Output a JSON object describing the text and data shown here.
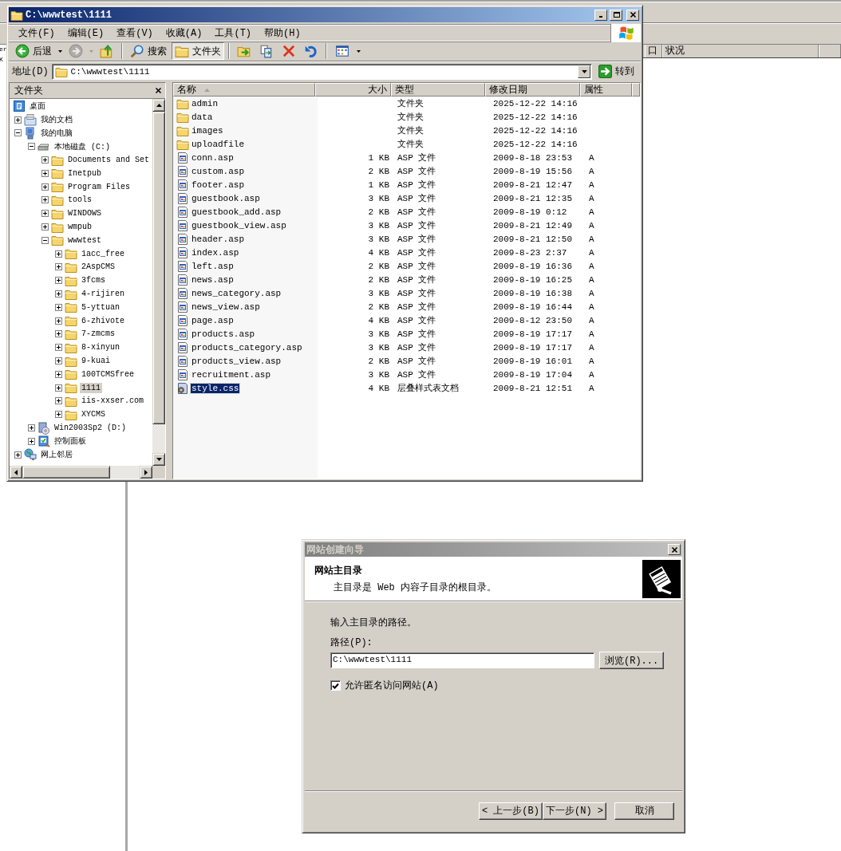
{
  "background_window": {
    "left_texts": [
      "er",
      "K"
    ],
    "columns": [
      "口",
      "状况"
    ]
  },
  "explorer": {
    "title": "C:\\wwwtest\\1111",
    "menu": [
      "文件(F)",
      "编辑(E)",
      "查看(V)",
      "收藏(A)",
      "工具(T)",
      "帮助(H)"
    ],
    "toolbar": [
      [
        {
          "kind": "back",
          "label": "后退",
          "disabled": false,
          "selected": false
        },
        {
          "kind": "forward",
          "disabled": true,
          "selected": false
        },
        {
          "kind": "up",
          "disabled": false,
          "selected": false
        }
      ],
      [
        {
          "kind": "search",
          "label": "搜索",
          "disabled": false,
          "selected": false
        },
        {
          "kind": "folders",
          "label": "文件夹",
          "disabled": false,
          "selected": true
        }
      ],
      [
        {
          "kind": "move",
          "disabled": false,
          "selected": false
        },
        {
          "kind": "copy",
          "disabled": false,
          "selected": false
        },
        {
          "kind": "delete",
          "disabled": false,
          "selected": false
        },
        {
          "kind": "undo",
          "disabled": false,
          "selected": false
        }
      ],
      [
        {
          "kind": "views",
          "disabled": false,
          "selected": false
        }
      ]
    ],
    "address": {
      "label": "地址(D)",
      "value": "C:\\wwwtest\\1111",
      "go": "转到"
    },
    "folders": {
      "title": "文件夹",
      "tree": [
        {
          "kind": "desktop",
          "label": "桌面",
          "selected": false,
          "children": [
            {
              "kind": "documents",
              "label": "我的文档",
              "expanded": false,
              "selected": false
            },
            {
              "kind": "computer",
              "label": "我的电脑",
              "expanded": true,
              "selected": false,
              "children": [
                {
                  "kind": "drive",
                  "label": "本地磁盘 (C:)",
                  "expanded": true,
                  "selected": false,
                  "children": [
                    {
                      "kind": "folder",
                      "label": "Documents and Set",
                      "expanded": false,
                      "selected": false
                    },
                    {
                      "kind": "folder",
                      "label": "Inetpub",
                      "expanded": false,
                      "selected": false
                    },
                    {
                      "kind": "folder",
                      "label": "Program Files",
                      "expanded": false,
                      "selected": false
                    },
                    {
                      "kind": "folder",
                      "label": "tools",
                      "expanded": false,
                      "selected": false
                    },
                    {
                      "kind": "folder",
                      "label": "WINDOWS",
                      "expanded": false,
                      "selected": false
                    },
                    {
                      "kind": "folder",
                      "label": "wmpub",
                      "expanded": false,
                      "selected": false
                    },
                    {
                      "kind": "folder",
                      "label": "wwwtest",
                      "expanded": true,
                      "selected": false,
                      "children": [
                        {
                          "kind": "folder",
                          "label": "1acc_free",
                          "expanded": false,
                          "selected": false
                        },
                        {
                          "kind": "folder",
                          "label": "2AspCMS",
                          "expanded": false,
                          "selected": false
                        },
                        {
                          "kind": "folder",
                          "label": "3fcms",
                          "expanded": false,
                          "selected": false
                        },
                        {
                          "kind": "folder",
                          "label": "4-rijiren",
                          "expanded": false,
                          "selected": false
                        },
                        {
                          "kind": "folder",
                          "label": "5-yttuan",
                          "expanded": false,
                          "selected": false
                        },
                        {
                          "kind": "folder",
                          "label": "6-zhivote",
                          "expanded": false,
                          "selected": false
                        },
                        {
                          "kind": "folder",
                          "label": "7-zmcms",
                          "expanded": false,
                          "selected": false
                        },
                        {
                          "kind": "folder",
                          "label": "8-xinyun",
                          "expanded": false,
                          "selected": false
                        },
                        {
                          "kind": "folder",
                          "label": "9-kuai",
                          "expanded": false,
                          "selected": false
                        },
                        {
                          "kind": "folder",
                          "label": "100TCMSfree",
                          "expanded": false,
                          "selected": false
                        },
                        {
                          "kind": "folder",
                          "label": "1111",
                          "expanded": false,
                          "selected": true
                        },
                        {
                          "kind": "folder",
                          "label": "iis-xxser.com",
                          "expanded": false,
                          "selected": false
                        },
                        {
                          "kind": "folder",
                          "label": "XYCMS",
                          "expanded": false,
                          "selected": false
                        }
                      ]
                    }
                  ]
                },
                {
                  "kind": "cd",
                  "label": "Win2003Sp2 (D:)",
                  "expanded": false,
                  "selected": false
                },
                {
                  "kind": "control",
                  "label": "控制面板",
                  "expanded": false,
                  "selected": false
                }
              ]
            },
            {
              "kind": "network",
              "label": "网上邻居",
              "expanded": false,
              "selected": false
            }
          ]
        }
      ]
    },
    "list": {
      "columns": [
        {
          "label": "名称",
          "sorted": true
        },
        {
          "label": "大小",
          "sorted": false
        },
        {
          "label": "类型",
          "sorted": false
        },
        {
          "label": "修改日期",
          "sorted": false
        },
        {
          "label": "属性",
          "sorted": false
        }
      ],
      "rows": [
        {
          "kind": "folder",
          "name": "admin",
          "type": "文件夹",
          "modified": "2025-12-22 14:16",
          "selected": false
        },
        {
          "kind": "folder",
          "name": "data",
          "type": "文件夹",
          "modified": "2025-12-22 14:16",
          "selected": false
        },
        {
          "kind": "folder",
          "name": "images",
          "type": "文件夹",
          "modified": "2025-12-22 14:16",
          "selected": false
        },
        {
          "kind": "folder",
          "name": "uploadfile",
          "type": "文件夹",
          "modified": "2025-12-22 14:16",
          "selected": false
        },
        {
          "kind": "asp",
          "name": "conn.asp",
          "size": "1 KB",
          "type": "ASP 文件",
          "modified": "2009-8-18 23:53",
          "attributes": "A",
          "selected": false
        },
        {
          "kind": "asp",
          "name": "custom.asp",
          "size": "2 KB",
          "type": "ASP 文件",
          "modified": "2009-8-19 15:56",
          "attributes": "A",
          "selected": false
        },
        {
          "kind": "asp",
          "name": "footer.asp",
          "size": "1 KB",
          "type": "ASP 文件",
          "modified": "2009-8-21 12:47",
          "attributes": "A",
          "selected": false
        },
        {
          "kind": "asp",
          "name": "guestbook.asp",
          "size": "3 KB",
          "type": "ASP 文件",
          "modified": "2009-8-21 12:35",
          "attributes": "A",
          "selected": false
        },
        {
          "kind": "asp",
          "name": "guestbook_add.asp",
          "size": "2 KB",
          "type": "ASP 文件",
          "modified": "2009-8-19 0:12",
          "attributes": "A",
          "selected": false
        },
        {
          "kind": "asp",
          "name": "guestbook_view.asp",
          "size": "3 KB",
          "type": "ASP 文件",
          "modified": "2009-8-21 12:49",
          "attributes": "A",
          "selected": false
        },
        {
          "kind": "asp",
          "name": "header.asp",
          "size": "3 KB",
          "type": "ASP 文件",
          "modified": "2009-8-21 12:50",
          "attributes": "A",
          "selected": false
        },
        {
          "kind": "asp",
          "name": "index.asp",
          "size": "4 KB",
          "type": "ASP 文件",
          "modified": "2009-8-23 2:37",
          "attributes": "A",
          "selected": false
        },
        {
          "kind": "asp",
          "name": "left.asp",
          "size": "2 KB",
          "type": "ASP 文件",
          "modified": "2009-8-19 16:36",
          "attributes": "A",
          "selected": false
        },
        {
          "kind": "asp",
          "name": "news.asp",
          "size": "2 KB",
          "type": "ASP 文件",
          "modified": "2009-8-19 16:25",
          "attributes": "A",
          "selected": false
        },
        {
          "kind": "asp",
          "name": "news_category.asp",
          "size": "3 KB",
          "type": "ASP 文件",
          "modified": "2009-8-19 16:38",
          "attributes": "A",
          "selected": false
        },
        {
          "kind": "asp",
          "name": "news_view.asp",
          "size": "2 KB",
          "type": "ASP 文件",
          "modified": "2009-8-19 16:44",
          "attributes": "A",
          "selected": false
        },
        {
          "kind": "asp",
          "name": "page.asp",
          "size": "4 KB",
          "type": "ASP 文件",
          "modified": "2009-8-12 23:50",
          "attributes": "A",
          "selected": false
        },
        {
          "kind": "asp",
          "name": "products.asp",
          "size": "3 KB",
          "type": "ASP 文件",
          "modified": "2009-8-19 17:17",
          "attributes": "A",
          "selected": false
        },
        {
          "kind": "asp",
          "name": "products_category.asp",
          "size": "3 KB",
          "type": "ASP 文件",
          "modified": "2009-8-19 17:17",
          "attributes": "A",
          "selected": false
        },
        {
          "kind": "asp",
          "name": "products_view.asp",
          "size": "2 KB",
          "type": "ASP 文件",
          "modified": "2009-8-19 16:01",
          "attributes": "A",
          "selected": false
        },
        {
          "kind": "asp",
          "name": "recruitment.asp",
          "size": "3 KB",
          "type": "ASP 文件",
          "modified": "2009-8-19 17:04",
          "attributes": "A",
          "selected": false
        },
        {
          "kind": "css",
          "name": "style.css",
          "size": "4 KB",
          "type": "层叠样式表文档",
          "modified": "2009-8-21 12:51",
          "attributes": "A",
          "selected": true
        }
      ]
    }
  },
  "wizard": {
    "title": "网站创建向导",
    "heading": "网站主目录",
    "subheading": "主目录是 Web 内容子目录的根目录。",
    "prompt": "输入主目录的路径。",
    "path_label": "路径(P):",
    "path_value": "C:\\wwwtest\\1111",
    "browse": "浏览(R)...",
    "anonymous": {
      "label": "允许匿名访问网站(A)",
      "checked": true
    },
    "buttons": [
      "< 上一步(B)",
      "下一步(N) >",
      "取消"
    ]
  }
}
